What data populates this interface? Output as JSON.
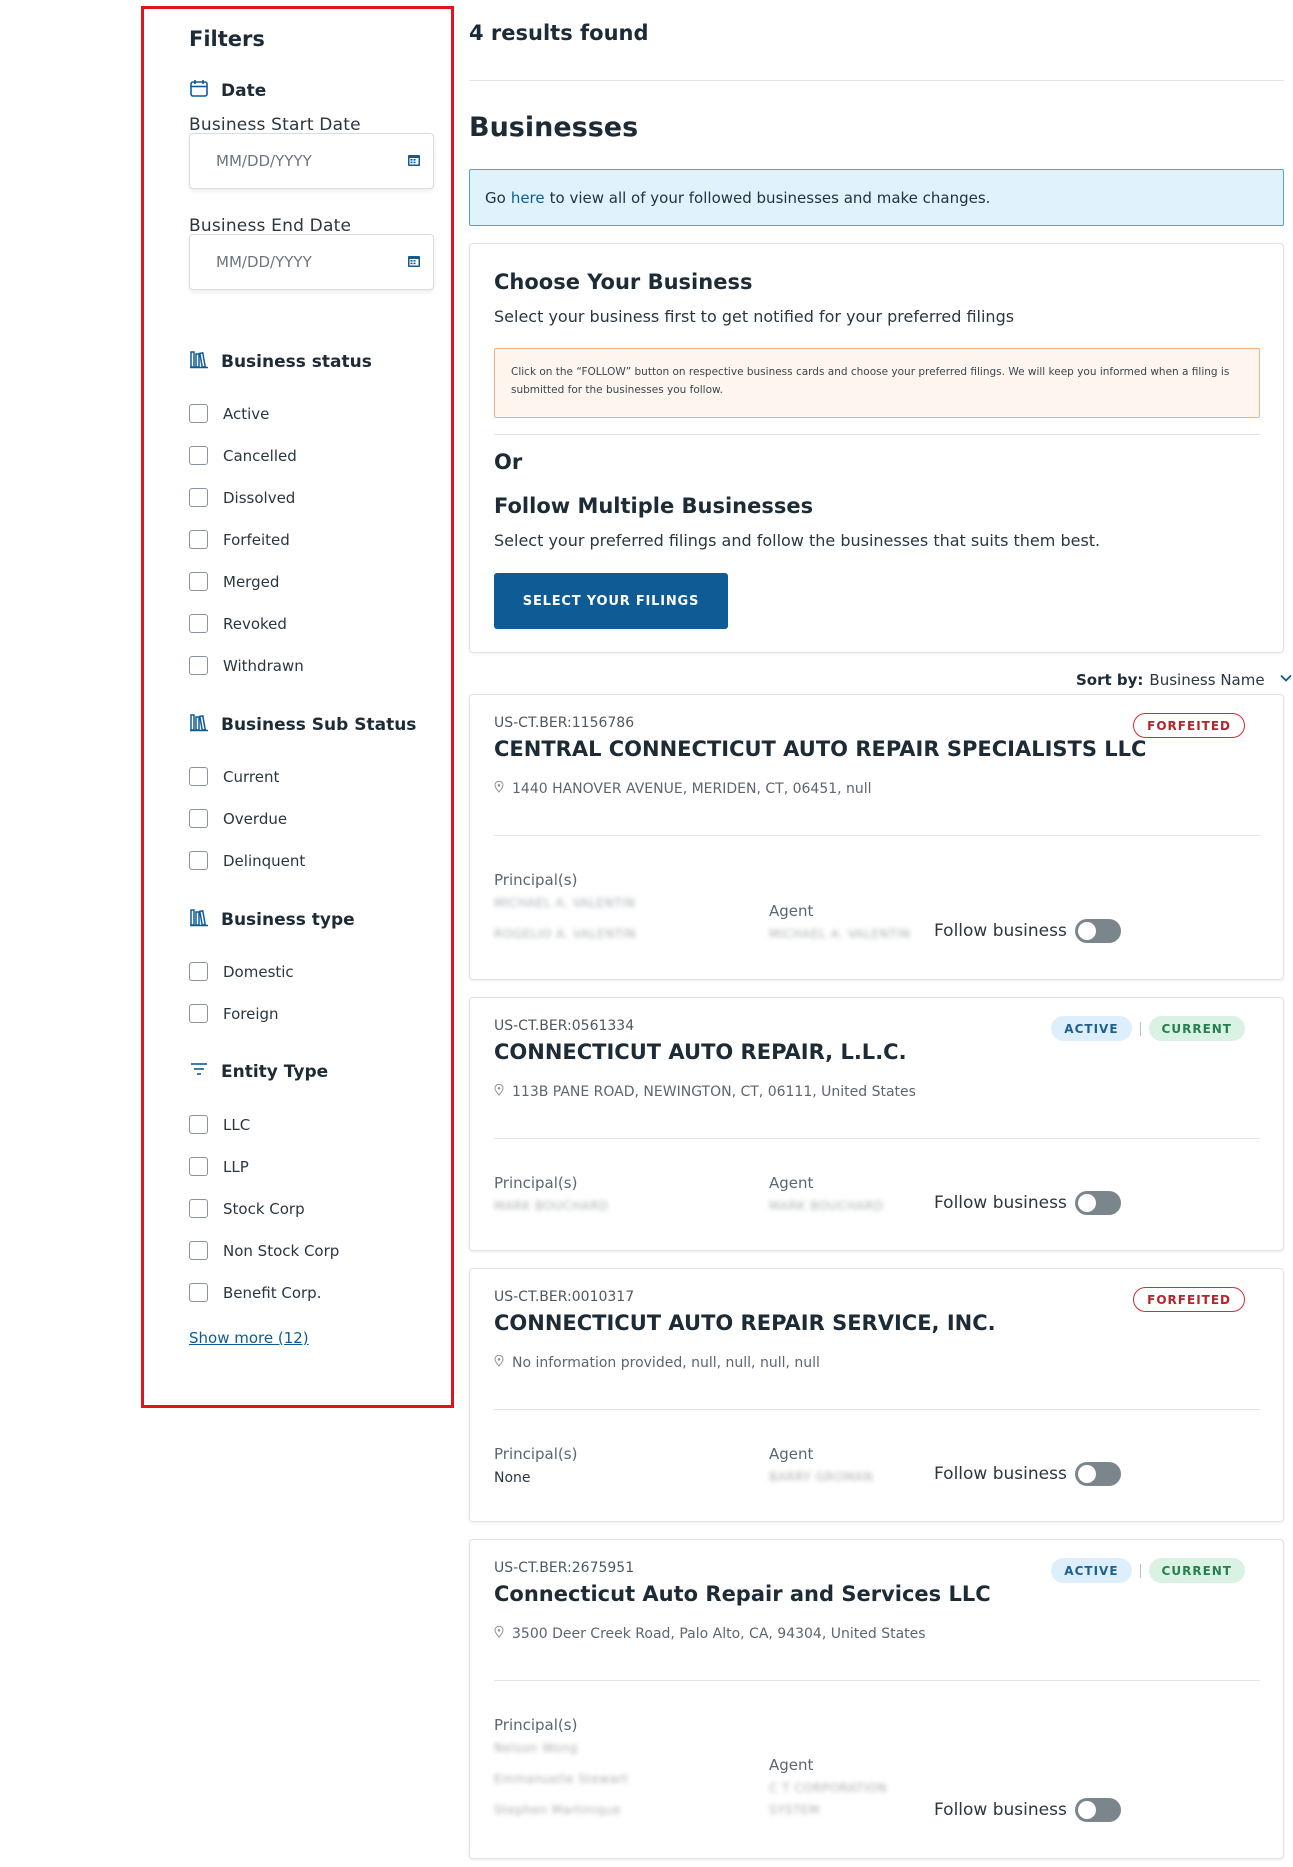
{
  "sidebar": {
    "title": "Filters",
    "date": {
      "heading": "Date",
      "start_label": "Business Start Date",
      "start_placeholder": "MM/DD/YYYY",
      "end_label": "Business End Date",
      "end_placeholder": "MM/DD/YYYY"
    },
    "status": {
      "heading": "Business status",
      "options": [
        "Active",
        "Cancelled",
        "Dissolved",
        "Forfeited",
        "Merged",
        "Revoked",
        "Withdrawn"
      ]
    },
    "sub_status": {
      "heading": "Business Sub Status",
      "options": [
        "Current",
        "Overdue",
        "Delinquent"
      ]
    },
    "type": {
      "heading": "Business type",
      "options": [
        "Domestic",
        "Foreign"
      ]
    },
    "entity": {
      "heading": "Entity Type",
      "options": [
        "LLC",
        "LLP",
        "Stock Corp",
        "Non Stock Corp",
        "Benefit Corp."
      ]
    },
    "show_more": "Show more (12)"
  },
  "main": {
    "results": "4 results found",
    "heading": "Businesses",
    "banner": {
      "prefix": "Go",
      "link": "here",
      "suffix": "to view all of your followed businesses and make changes."
    },
    "choose": {
      "title": "Choose Your Business",
      "subtitle": "Select your business first to get notified for your preferred filings",
      "notice": "Click on the “FOLLOW” button on respective business cards and choose your preferred filings. We will keep you informed when a filing is submitted for the businesses you follow.",
      "or": "Or",
      "multi_title": "Follow Multiple Businesses",
      "multi_subtitle": "Select your preferred filings and follow the businesses that suits them best.",
      "button": "SELECT YOUR FILINGS"
    },
    "sort": {
      "label": "Sort by:",
      "value": "Business Name"
    },
    "principals_label": "Principal(s)",
    "agent_label": "Agent",
    "follow_label": "Follow business",
    "businesses": [
      {
        "id": "US-CT.BER:1156786",
        "name": "CENTRAL CONNECTICUT AUTO REPAIR SPECIALISTS LLC",
        "address": "1440 HANOVER AVENUE, MERIDEN, CT, 06451, null",
        "badges": [
          "FORFEITED"
        ],
        "principals": [
          "MICHAEL A. VALENTIN",
          "ROGELIO A. VALENTIN"
        ],
        "agent": [
          "MICHAEL A. VALENTIN"
        ],
        "follow_on": false
      },
      {
        "id": "US-CT.BER:0561334",
        "name": "CONNECTICUT AUTO REPAIR, L.L.C.",
        "address": "113B PANE ROAD, NEWINGTON, CT, 06111, United States",
        "badges": [
          "ACTIVE",
          "CURRENT"
        ],
        "principals": [
          "MARK BOUCHARD"
        ],
        "agent": [
          "MARK BOUCHARD"
        ],
        "follow_on": false
      },
      {
        "id": "US-CT.BER:0010317",
        "name": "CONNECTICUT AUTO REPAIR SERVICE, INC.",
        "address": "No information provided, null, null, null, null",
        "badges": [
          "FORFEITED"
        ],
        "principals": [
          "None"
        ],
        "agent": [
          "BARRY GROMAN"
        ],
        "follow_on": false
      },
      {
        "id": "US-CT.BER:2675951",
        "name": "Connecticut Auto Repair and Services LLC",
        "address": "3500 Deer Creek Road, Palo Alto, CA, 94304, United States",
        "badges": [
          "ACTIVE",
          "CURRENT"
        ],
        "principals": [
          "Nelson Wong",
          "Emmanuelle Stewart",
          "Stephen Martinique"
        ],
        "agent": [
          "C T CORPORATION",
          "SYSTEM"
        ],
        "follow_on": false
      }
    ]
  }
}
